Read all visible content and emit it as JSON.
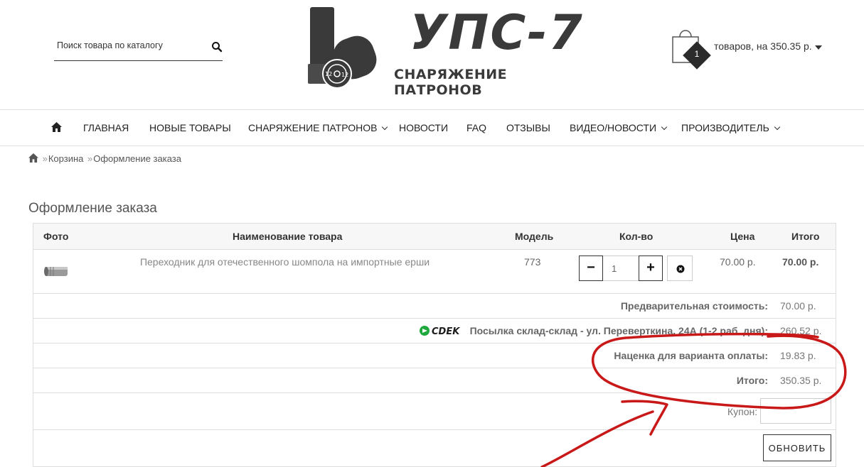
{
  "search": {
    "placeholder": "Поиск товара по каталогу"
  },
  "logo": {
    "title": "УПС-7",
    "subtitle": "СНАРЯЖЕНИЕ ПАТРОНОВ",
    "gauge_mark": "12"
  },
  "cart": {
    "count": "1",
    "summary": "товаров, на 350.35 р."
  },
  "nav": {
    "items": [
      {
        "label": "Главная"
      },
      {
        "label": "Новые товары"
      },
      {
        "label": "Снаряжение патронов"
      },
      {
        "label": "Новости"
      },
      {
        "label": "FAQ"
      },
      {
        "label": "Отзывы"
      },
      {
        "label": "Видео/Новости"
      },
      {
        "label": "Производитель"
      }
    ]
  },
  "breadcrumb": {
    "sep": "»",
    "items": [
      "Корзина",
      "Оформление заказа"
    ]
  },
  "page": {
    "title": "Оформление заказа"
  },
  "table": {
    "headers": [
      "Фото",
      "Наименование товара",
      "Модель",
      "Кол-во",
      "Цена",
      "Итого"
    ],
    "item": {
      "name": "Переходник для отечественного шомпола на импортные ерши",
      "model": "773",
      "qty": "1",
      "price": "70.00 р.",
      "total": "70.00 р."
    },
    "totals": [
      {
        "label": "Предварительная стоимость:",
        "value": "70.00 р."
      },
      {
        "label": "Посылка склад-склад - ул. Переверткина, 24А (1-2 раб. дня):",
        "value": "260.52 р.",
        "logo_text": "CDEK"
      },
      {
        "label": "Наценка для варианта оплаты:",
        "value": "19.83 р."
      },
      {
        "label": "Итого:",
        "value": "350.35 р."
      }
    ],
    "coupon_label": "Купон:",
    "update_label": "ОБНОВИТЬ"
  },
  "colors": {
    "annotation": "#c81818",
    "text": "#333333",
    "sdek_green": "#1fa83c"
  }
}
